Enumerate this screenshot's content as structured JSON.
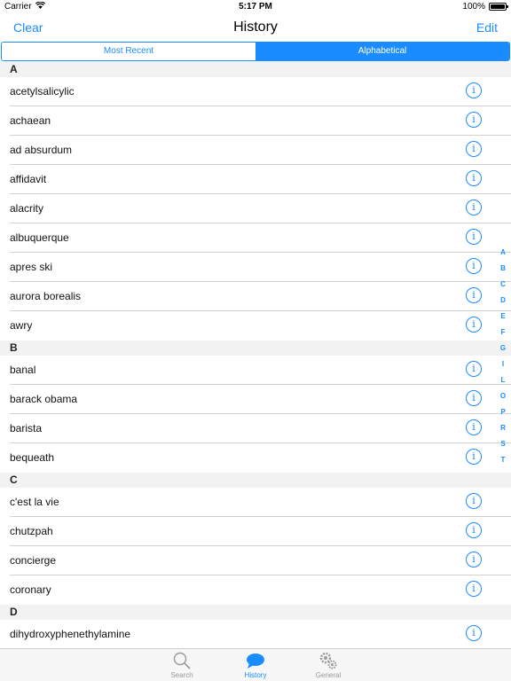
{
  "status_bar": {
    "carrier": "Carrier",
    "time": "5:17 PM",
    "battery": "100%"
  },
  "nav": {
    "left": "Clear",
    "title": "History",
    "right": "Edit"
  },
  "segments": {
    "most_recent": "Most Recent",
    "alphabetical": "Alphabetical",
    "selected": "Alphabetical"
  },
  "sections": [
    {
      "letter": "A",
      "items": [
        "acetylsalicylic",
        "achaean",
        "ad absurdum",
        "affidavit",
        "alacrity",
        "albuquerque",
        "apres ski",
        "aurora borealis",
        "awry"
      ]
    },
    {
      "letter": "B",
      "items": [
        "banal",
        "barack obama",
        "barista",
        "bequeath"
      ]
    },
    {
      "letter": "C",
      "items": [
        "c'est la vie",
        "chutzpah",
        "concierge",
        "coronary"
      ]
    },
    {
      "letter": "D",
      "items": [
        "dihydroxyphenethylamine"
      ]
    }
  ],
  "index": [
    "A",
    "B",
    "C",
    "D",
    "E",
    "F",
    "G",
    "I",
    "L",
    "O",
    "P",
    "R",
    "S",
    "T"
  ],
  "tabs": {
    "search": "Search",
    "history": "History",
    "general": "General"
  },
  "colors": {
    "accent": "#1a8cff",
    "section_bg": "#f2f2f2"
  },
  "icons": {
    "info": "info-circle-icon",
    "search": "magnifier-icon",
    "history": "speech-bubble-icon",
    "general": "gears-icon"
  }
}
